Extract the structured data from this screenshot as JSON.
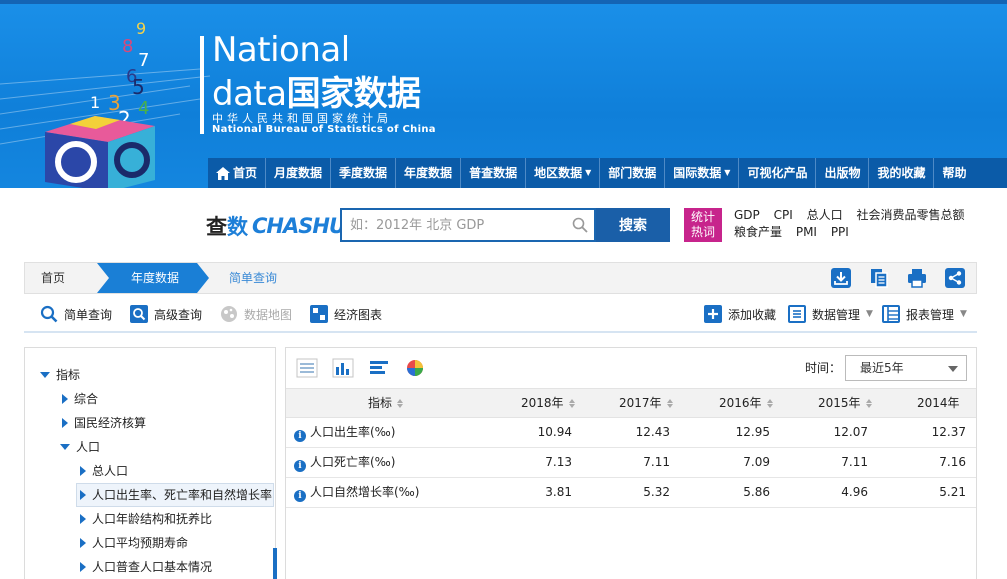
{
  "logo": {
    "line1": "National",
    "line2_en": "data",
    "line2_cn": "国家数据",
    "sub_cn": "中华人民共和国国家统计局",
    "sub_en": "National Bureau of Statistics of China",
    "cube_digits": [
      "9",
      "8",
      "7",
      "6",
      "5",
      "3",
      "4",
      "1",
      "2"
    ]
  },
  "nav": {
    "items": [
      {
        "label": "首页"
      },
      {
        "label": "月度数据"
      },
      {
        "label": "季度数据"
      },
      {
        "label": "年度数据"
      },
      {
        "label": "普查数据"
      },
      {
        "label": "地区数据"
      },
      {
        "label": "部门数据"
      },
      {
        "label": "国际数据"
      },
      {
        "label": "可视化产品"
      },
      {
        "label": "出版物"
      },
      {
        "label": "我的收藏"
      },
      {
        "label": "帮助"
      }
    ]
  },
  "search": {
    "brand_cn_1": "查",
    "brand_cn_2": "数",
    "brand_en": "CHASHU",
    "placeholder": "如：2012年 北京 GDP",
    "button": "搜索",
    "hot_tag_1": "统计",
    "hot_tag_2": "热词",
    "hot_words": [
      "GDP",
      "CPI",
      "总人口",
      "社会消费品零售总额",
      "粮食产量",
      "PMI",
      "PPI"
    ]
  },
  "breadcrumb": {
    "home": "首页",
    "year": "年度数据",
    "simple": "简单查询"
  },
  "query_bar": {
    "simple": "简单查询",
    "advanced": "高级查询",
    "map": "数据地图",
    "chart": "经济图表",
    "favorite": "添加收藏",
    "data_manage": "数据管理",
    "report_manage": "报表管理"
  },
  "tree": {
    "root": "指标",
    "items": [
      "综合",
      "国民经济核算",
      "人口",
      "总人口",
      "人口出生率、死亡率和自然增长率",
      "人口年龄结构和抚养比",
      "人口平均预期寿命",
      "人口普查人口基本情况"
    ]
  },
  "panel": {
    "time_label": "时间：",
    "time_value": "最近5年"
  },
  "table": {
    "indicator_header": "指标",
    "years": [
      "2018年",
      "2017年",
      "2016年",
      "2015年",
      "2014年"
    ],
    "rows": [
      {
        "name": "人口出生率(‰)",
        "values": [
          "10.94",
          "12.43",
          "12.95",
          "12.07",
          "12.37"
        ]
      },
      {
        "name": "人口死亡率(‰)",
        "values": [
          "7.13",
          "7.11",
          "7.09",
          "7.11",
          "7.16"
        ]
      },
      {
        "name": "人口自然增长率(‰)",
        "values": [
          "3.81",
          "5.32",
          "5.86",
          "4.96",
          "5.21"
        ]
      }
    ]
  },
  "colors": {
    "header_blue": "#0f7fd9",
    "nav_dark": "#0b5ba8",
    "accent_blue": "#1a6fc4",
    "hot_tag": "#c7248c"
  }
}
